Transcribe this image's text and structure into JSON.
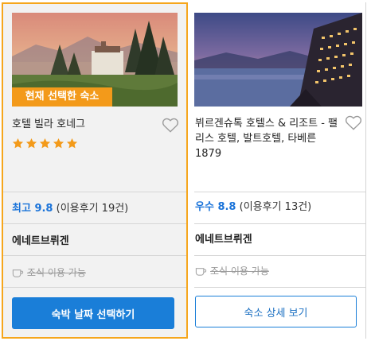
{
  "cards": [
    {
      "badge": "현재 선택한 숙소",
      "name": "호텔 빌라 호네그",
      "stars": 5,
      "rating_grade": "최고 9.8",
      "rating_reviews": "(이용후기 19건)",
      "location": "에네트브뤼겐",
      "amenity": "조식 이용 가능",
      "button": "숙박 날짜 선택하기"
    },
    {
      "name": "뷔르겐슈톡 호텔스 & 리조트 - 팰리스 호텔, 발트호텔, 타베른 1879",
      "rating_grade": "우수 8.8",
      "rating_reviews": "(이용후기 13건)",
      "location": "에네트브뤼겐",
      "amenity": "조식 이용 가능",
      "button": "숙소 상세 보기"
    }
  ],
  "icons": {
    "favorite": "heart-outline-icon",
    "star": "star-icon",
    "breakfast": "coffee-cup-icon"
  },
  "colors": {
    "selected_border": "#f6a61c",
    "badge_bg": "#f39a1a",
    "star": "#f39a1a",
    "rating_grade": "#1a73d9",
    "primary_button": "#1a7ed8"
  }
}
